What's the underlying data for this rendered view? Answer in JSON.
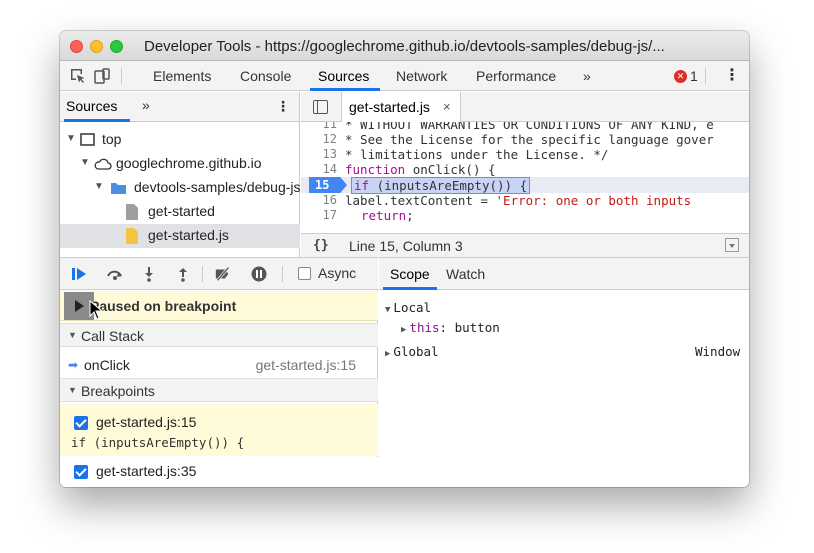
{
  "window": {
    "title": "Developer Tools - https://googlechrome.github.io/devtools-samples/debug-js/..."
  },
  "main_tabs": [
    {
      "label": "Elements"
    },
    {
      "label": "Console"
    },
    {
      "label": "Sources"
    },
    {
      "label": "Network"
    },
    {
      "label": "Performance"
    }
  ],
  "main_tabs_more": "»",
  "error_count": "1",
  "navigator": {
    "tab": "Sources",
    "more": "»",
    "tree": [
      {
        "label": "top"
      },
      {
        "label": "googlechrome.github.io"
      },
      {
        "label": "devtools-samples/debug-js"
      },
      {
        "label": "get-started"
      },
      {
        "label": "get-started.js"
      }
    ]
  },
  "editor": {
    "tab_label": "get-started.js",
    "tab_close": "×",
    "lines": [
      {
        "num": "11",
        "text": " * WITHOUT WARRANTIES OR CONDITIONS OF ANY KIND, e"
      },
      {
        "num": "12",
        "text": " * See the License for the specific language gover"
      },
      {
        "num": "13",
        "text": " * limitations under the License. */"
      },
      {
        "num": "14",
        "kw": "function",
        "text": " onClick() {"
      },
      {
        "num": "15",
        "kw": "if",
        "text": " (inputsAreEmpty()) {"
      },
      {
        "num": "16",
        "pre": "  label.textContent = ",
        "str": "'Error: one or both inputs"
      },
      {
        "num": "17",
        "kw": "return",
        "text": ";"
      }
    ],
    "status_braces": "{}",
    "status_position": "Line 15, Column 3"
  },
  "debugger": {
    "async_label": "Async",
    "paused_label": "Paused on breakpoint",
    "call_stack_header": "Call Stack",
    "frames": [
      {
        "fn": "onClick",
        "loc": "get-started.js:15"
      }
    ],
    "breakpoints_header": "Breakpoints",
    "breakpoints": [
      {
        "name": "get-started.js:15",
        "code": "if (inputsAreEmpty()) {"
      },
      {
        "name": "get-started.js:35"
      }
    ]
  },
  "scope": {
    "tabs": [
      {
        "label": "Scope"
      },
      {
        "label": "Watch"
      }
    ],
    "local_label": "Local",
    "this_key": "this",
    "this_value": "button",
    "global_label": "Global",
    "global_value": "Window"
  },
  "colors": {
    "accent": "#1a73e8",
    "paused_bg": "#fffbd8",
    "breakpoint": "#4285f4",
    "error": "#d93025"
  }
}
